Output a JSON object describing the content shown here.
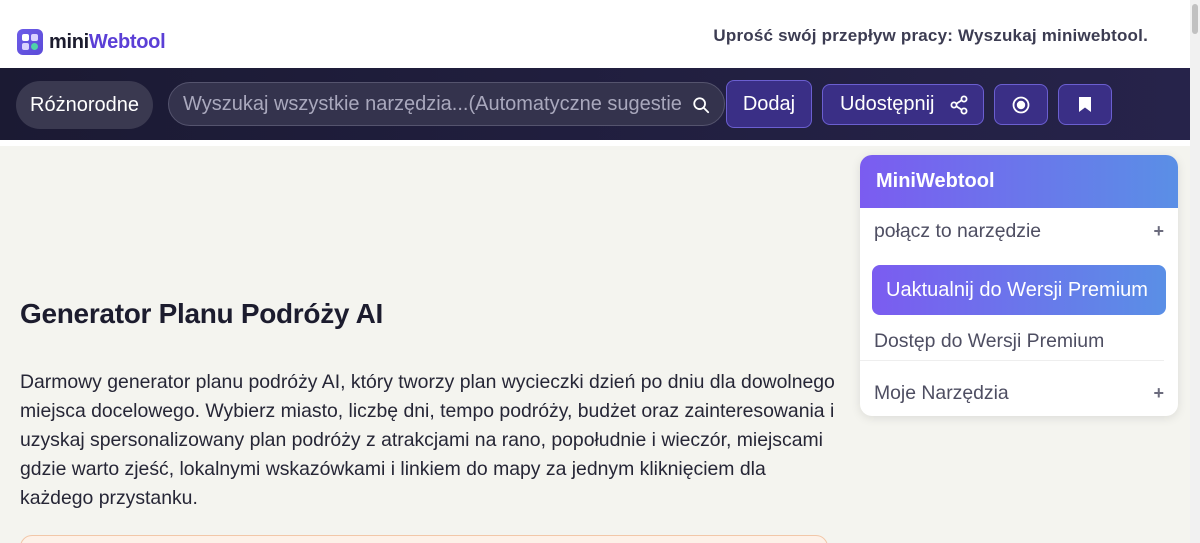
{
  "header": {
    "logo_part1": "mini",
    "logo_part2": "Webtool",
    "tagline": "Uprość swój przepływ pracy: Wyszukaj miniwebtool."
  },
  "nav": {
    "category_label": "Różnorodne",
    "search_placeholder": "Wyszukaj wszystkie narzędzia...(Automatyczne sugestie",
    "add_label": "Dodaj",
    "share_label": "Udostępnij"
  },
  "main": {
    "title": "Generator Planu Podróży AI",
    "description": "Darmowy generator planu podróży AI, który tworzy plan wycieczki dzień po dniu dla dowolnego miejsca docelowego. Wybierz miasto, liczbę dni, tempo podróży, budżet oraz zainteresowania i uzyskaj spersonalizowany plan podróży z atrakcjami na rano, popołudnie i wieczór, miejscami gdzie warto zjeść, lokalnymi wskazówkami i linkiem do mapy za jednym kliknięciem dla każdego przystanku."
  },
  "panel": {
    "title": "MiniWebtool",
    "connect_label": "połącz to narzędzie",
    "upgrade_label": "Uaktualnij do Wersji Premium",
    "access_label": "Dostęp do Wersji Premium",
    "tools_label": "Moje Narzędzia",
    "plus": "+"
  },
  "icons": {
    "search": "search-icon",
    "share": "share-icon",
    "record": "record-icon",
    "bookmark": "bookmark-icon"
  },
  "colors": {
    "nav_bg": "#1b1a33",
    "accent": "#5b3fd6",
    "gradient_start": "#7b5cf0",
    "gradient_end": "#5a8fe6"
  }
}
